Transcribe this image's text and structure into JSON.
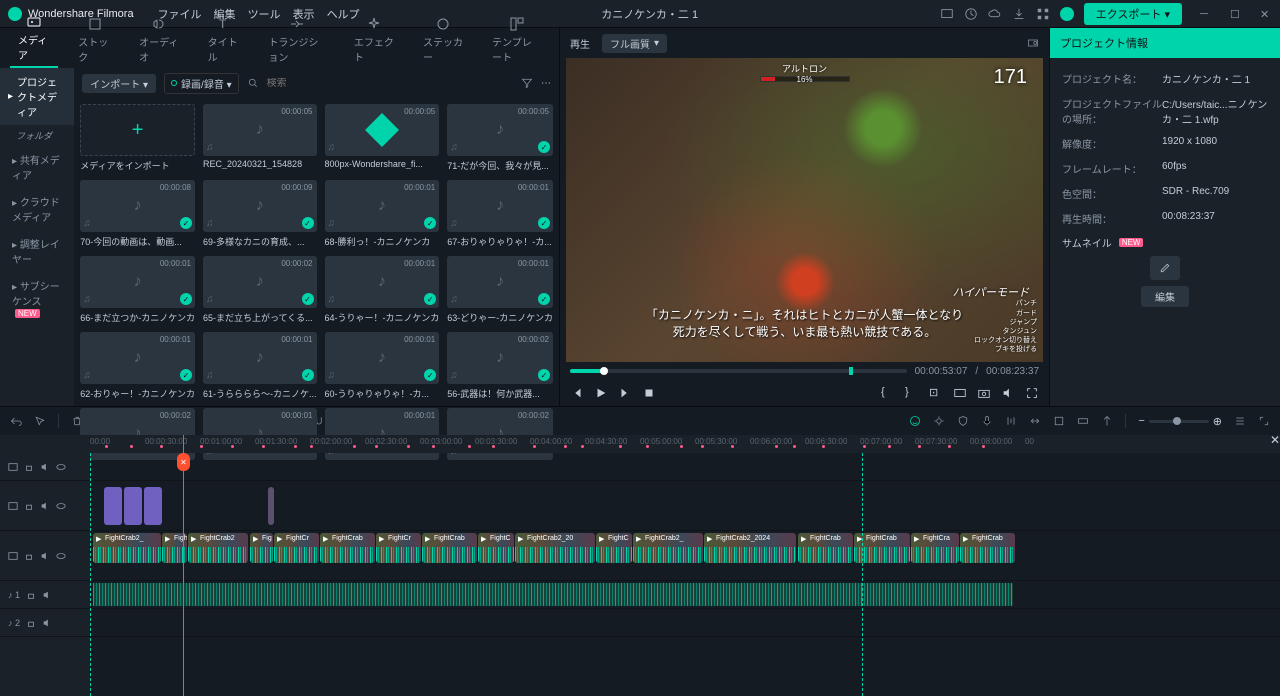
{
  "app": {
    "name": "Wondershare Filmora",
    "document": "カニノケンカ・二 1"
  },
  "menu": [
    "ファイル",
    "編集",
    "ツール",
    "表示",
    "ヘルプ"
  ],
  "export_btn": "エクスポート ▾",
  "tabs": [
    {
      "label": "メディア",
      "active": true
    },
    {
      "label": "ストック"
    },
    {
      "label": "オーディオ"
    },
    {
      "label": "タイトル"
    },
    {
      "label": "トランジション"
    },
    {
      "label": "エフェクト"
    },
    {
      "label": "ステッカー"
    },
    {
      "label": "テンプレート"
    }
  ],
  "sidebar": {
    "header": "プロジェクトメディア",
    "folder": "フォルダ",
    "items": [
      "共有メディア",
      "クラウド メディア",
      "調整レイヤー"
    ],
    "subseq": "サブシーケンス",
    "new": "NEW"
  },
  "toolbar": {
    "import": "インポート ▾",
    "record": "録画/録音 ▾",
    "search_ph": "検索"
  },
  "thumbs": [
    {
      "label": "メディアをインポート",
      "kind": "import"
    },
    {
      "label": "REC_20240321_154828",
      "dur": "00:00:05",
      "kind": "audio"
    },
    {
      "label": "800px-Wondershare_fi...",
      "dur": "00:00:05",
      "kind": "filmora"
    },
    {
      "label": "71-だが今回、我々が見...",
      "dur": "00:00:05",
      "kind": "audio",
      "check": true
    },
    {
      "label": "70-今回の動画は、動画...",
      "dur": "00:00:08",
      "kind": "audio",
      "check": true
    },
    {
      "label": "69-多様なカニの育成、...",
      "dur": "00:00:09",
      "kind": "audio",
      "check": true
    },
    {
      "label": "68-勝利っ！-カニノケンカ",
      "dur": "00:00:01",
      "kind": "audio",
      "check": true
    },
    {
      "label": "67-おりゃりゃりゃ！-カ...",
      "dur": "00:00:01",
      "kind": "audio",
      "check": true
    },
    {
      "label": "66-まだ立つか-カニノケンカ",
      "dur": "00:00:01",
      "kind": "audio",
      "check": true
    },
    {
      "label": "65-まだ立ち上がってくる...",
      "dur": "00:00:02",
      "kind": "audio",
      "check": true
    },
    {
      "label": "64-うりゃー！-カニノケンカ",
      "dur": "00:00:01",
      "kind": "audio",
      "check": true
    },
    {
      "label": "63-どりゃー-カニノケンカ",
      "dur": "00:00:01",
      "kind": "audio",
      "check": true
    },
    {
      "label": "62-おりゃー！-カニノケンカ",
      "dur": "00:00:01",
      "kind": "audio",
      "check": true
    },
    {
      "label": "61-うらららら～-カニノケ...",
      "dur": "00:00:01",
      "kind": "audio",
      "check": true
    },
    {
      "label": "60-うりゃりゃりゃ！-カ...",
      "dur": "00:00:01",
      "kind": "audio",
      "check": true
    },
    {
      "label": "56-武器は！何か武器...",
      "dur": "00:00:02",
      "kind": "audio",
      "check": true
    },
    {
      "label": "",
      "dur": "00:00:02",
      "kind": "audio"
    },
    {
      "label": "",
      "dur": "00:00:01",
      "kind": "audio"
    },
    {
      "label": "",
      "dur": "00:00:01",
      "kind": "audio"
    },
    {
      "label": "",
      "dur": "00:00:02",
      "kind": "audio"
    }
  ],
  "preview": {
    "play_label": "再生",
    "quality": "フル画質",
    "boss": "アルトロン",
    "hp_pct": "16%",
    "score": "171",
    "mode": "ハイパーモード",
    "sub1": "「カニノケンカ・ニ」。それはヒトとカニが人蟹一体となり",
    "sub2": "死力を尽くして戦う、いま最も熱い競技である。",
    "hints": "パンチ\nガード\nジャンプ\nタンジュン\nロックオン切り替え\nブキを投げる",
    "cur_time": "00:00:53:07",
    "total_time": "00:08:23:37"
  },
  "props": {
    "header": "プロジェクト情報",
    "rows": [
      {
        "l": "プロジェクト名：",
        "v": "カニノケンカ・二 1"
      },
      {
        "l": "プロジェクトファイルの場所：",
        "v": "C:/Users/taic...ニノケンカ・二 1.wfp"
      },
      {
        "l": "解像度：",
        "v": "1920 x 1080"
      },
      {
        "l": "フレームレート：",
        "v": "60fps"
      },
      {
        "l": "色空間：",
        "v": "SDR - Rec.709"
      },
      {
        "l": "再生時間：",
        "v": "00:08:23:37"
      }
    ],
    "thumbnail": "サムネイル",
    "new": "NEW",
    "edit": "編集"
  },
  "ruler": [
    "00:00",
    "00:00:30:00",
    "00:01:00:00",
    "00:01:30:00",
    "00:02:00:00",
    "00:02:30:00",
    "00:03:00:00",
    "00:03:30:00",
    "00:04:00:00",
    "00:04:30:00",
    "00:05:00:00",
    "00:05:30:00",
    "00:06:00:00",
    "00:06:30:00",
    "00:07:00:00",
    "00:07:30:00",
    "00:08:00:00",
    "00"
  ],
  "track_labels": {
    "b1": "",
    "v1": "",
    "a1": "♪ 1",
    "a2": "♪ 2"
  },
  "clip_name": "FightCrab2_2024"
}
